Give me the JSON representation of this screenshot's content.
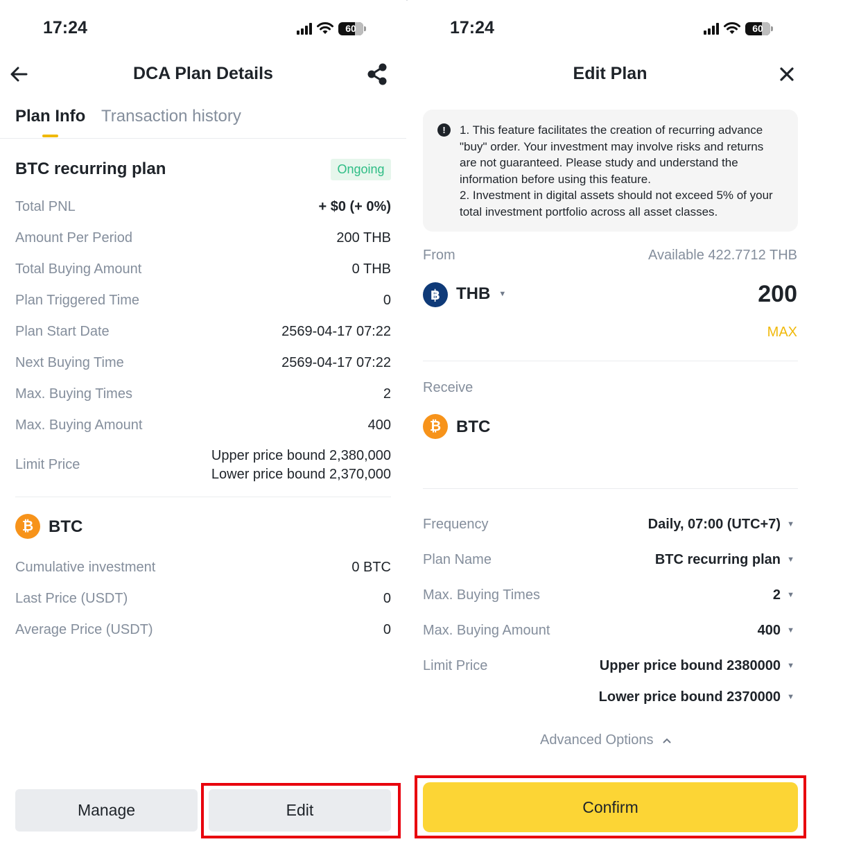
{
  "left_screen": {
    "status_bar": {
      "time": "17:24",
      "battery": "60"
    },
    "header": {
      "title": "DCA Plan Details",
      "back_icon": "arrow-left-icon",
      "share_icon": "share-icon"
    },
    "tabs": [
      {
        "label": "Plan Info",
        "active": true
      },
      {
        "label": "Transaction history",
        "active": false
      }
    ],
    "plan": {
      "name": "BTC recurring plan",
      "status": "Ongoing",
      "rows": [
        {
          "label": "Total PNL",
          "value": "+ $0 (+ 0%)"
        },
        {
          "label": "Amount Per Period",
          "value": "200 THB"
        },
        {
          "label": "Total Buying Amount",
          "value": "0 THB"
        },
        {
          "label": "Plan Triggered Time",
          "value": "0"
        },
        {
          "label": "Plan Start Date",
          "value": "2569-04-17 07:22"
        },
        {
          "label": "Next Buying Time",
          "value": "2569-04-17 07:22"
        },
        {
          "label": "Max. Buying Times",
          "value": "2"
        },
        {
          "label": "Max. Buying Amount",
          "value": "400"
        }
      ],
      "limit_price": {
        "label": "Limit Price",
        "upper": "Upper price bound 2,380,000",
        "lower": "Lower price bound 2,370,000"
      }
    },
    "asset": {
      "coin_symbol": "₿",
      "name": "BTC",
      "rows": [
        {
          "label": "Cumulative investment",
          "value": "0 BTC"
        },
        {
          "label": "Last Price (USDT)",
          "value": "0"
        },
        {
          "label": "Average Price (USDT)",
          "value": "0"
        }
      ]
    },
    "buttons": {
      "manage": "Manage",
      "edit": "Edit"
    }
  },
  "right_screen": {
    "status_bar": {
      "time": "17:24",
      "battery": "60"
    },
    "header": {
      "title": "Edit Plan",
      "close_icon": "close-icon"
    },
    "notice": {
      "icon": "!",
      "line1": "1. This feature facilitates the creation of recurring advance \"buy\" order. Your investment may involve risks and returns are not guaranteed. Please study and understand the information before using this feature.",
      "line2": "2. Investment in digital assets should not exceed 5% of your total investment portfolio across all asset classes."
    },
    "from": {
      "label": "From",
      "available": "Available 422.7712 THB",
      "coin_symbol": "฿",
      "currency": "THB",
      "amount": "200",
      "max_label": "MAX"
    },
    "receive": {
      "label": "Receive",
      "coin_symbol": "₿",
      "currency": "BTC"
    },
    "settings": [
      {
        "label": "Frequency",
        "value": "Daily, 07:00 (UTC+7)"
      },
      {
        "label": "Plan Name",
        "value": "BTC recurring plan"
      },
      {
        "label": "Max. Buying Times",
        "value": "2"
      },
      {
        "label": "Max. Buying Amount",
        "value": "400"
      }
    ],
    "limit_price": {
      "label": "Limit Price",
      "upper": "Upper price bound 2380000",
      "lower": "Lower price bound 2370000"
    },
    "advanced_options": "Advanced Options",
    "confirm": "Confirm"
  },
  "colors": {
    "accent_yellow": "#fcd535",
    "tab_indicator": "#f0b90b",
    "ongoing_green": "#2ebd85",
    "highlight_red": "#e8000d",
    "btc_orange": "#f7931a",
    "thb_navy": "#0f3a78"
  }
}
